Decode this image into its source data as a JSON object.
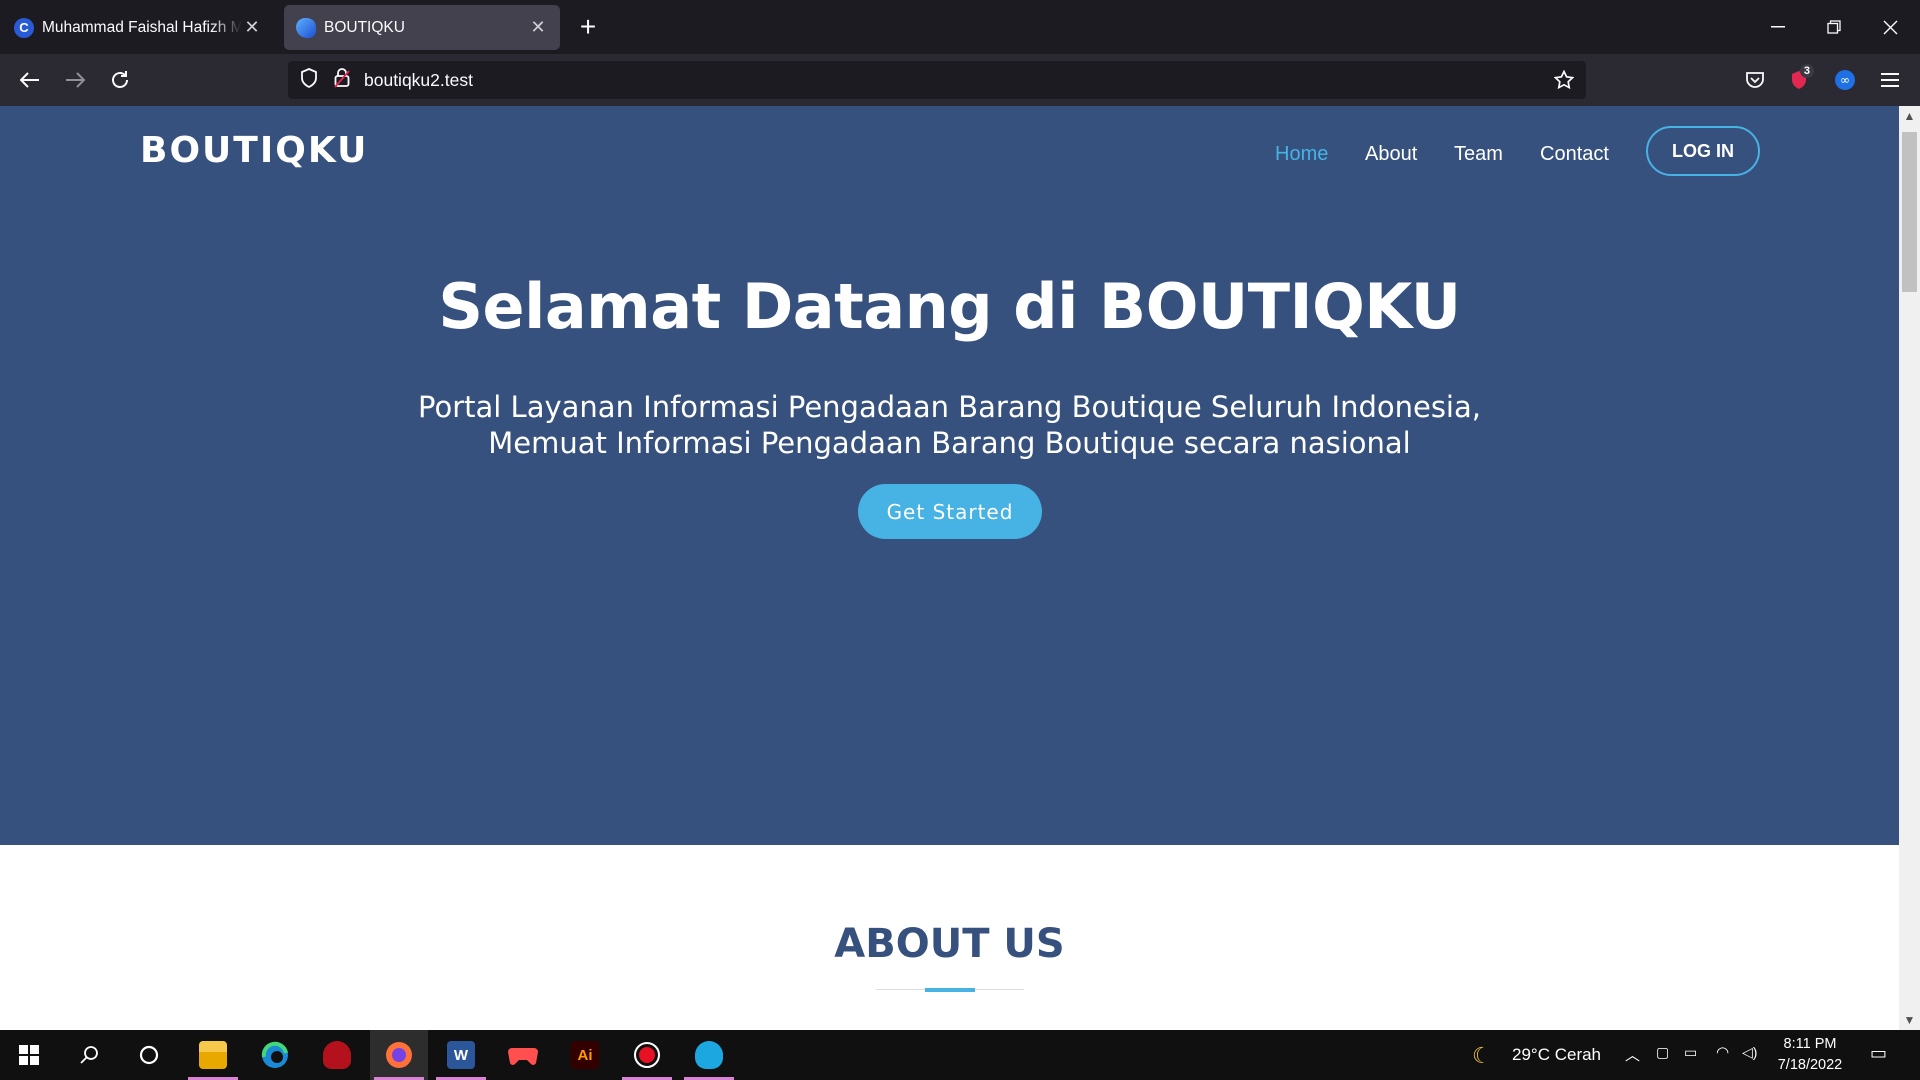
{
  "browser": {
    "tabs": [
      {
        "title": "Muhammad Faishal Hafizh Mun",
        "favicon": "C"
      },
      {
        "title": "BOUTIQKU"
      }
    ],
    "url": "boutiqku2.test",
    "extension_badge": "3"
  },
  "site": {
    "brand": "BOUTIQKU",
    "menu": [
      "Home",
      "About",
      "Team",
      "Contact"
    ],
    "login_label": "LOG IN",
    "hero_title": "Selamat Datang di BOUTIQKU",
    "hero_sub_line1": "Portal Layanan Informasi Pengadaan Barang Boutique Seluruh Indonesia,",
    "hero_sub_line2": "Memuat Informasi Pengadaan Barang Boutique secara nasional",
    "cta_label": "Get Started",
    "about_title": "ABOUT US",
    "colors": {
      "hero_bg": "#37517e",
      "accent": "#47b2e4"
    }
  },
  "taskbar": {
    "weather": "29°C  Cerah",
    "time": "8:11 PM",
    "date": "7/18/2022",
    "word_icon": "W",
    "illustrator_icon": "Ai"
  }
}
